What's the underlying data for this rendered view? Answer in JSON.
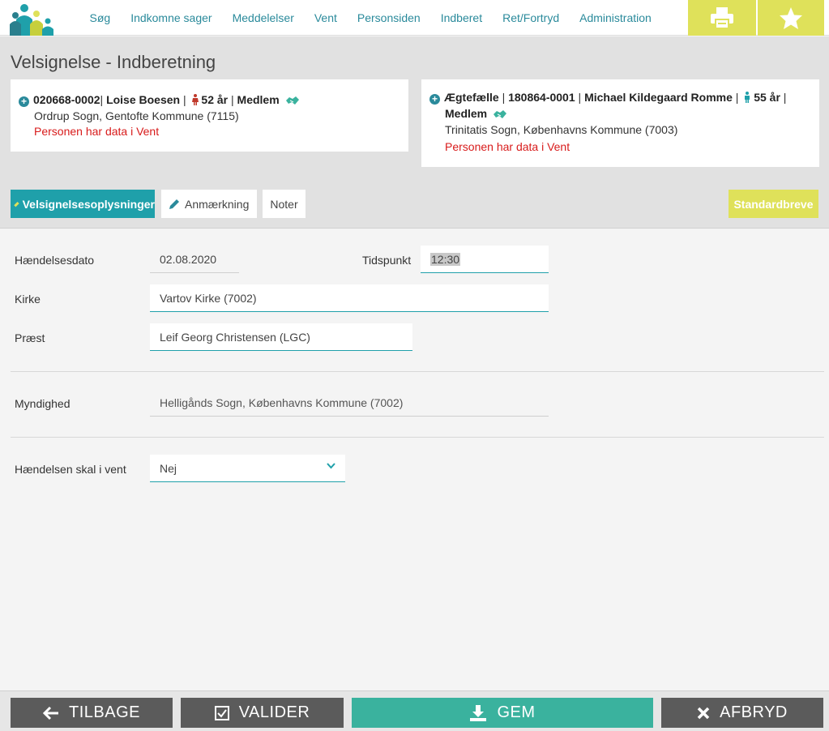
{
  "nav": {
    "items": [
      "Søg",
      "Indkomne sager",
      "Meddelelser",
      "Vent",
      "Personsiden",
      "Indberet",
      "Ret/Fortryd",
      "Administration"
    ]
  },
  "icons": {
    "logo": "people-logo-icon",
    "print": "printer-icon",
    "star": "star-icon",
    "expand": "plus-circle-icon",
    "gender_female": "female-person-icon",
    "gender_male": "male-person-icon",
    "member": "handshake-icon",
    "edit": "pencil-icon",
    "back": "arrow-left-icon",
    "validate": "checkbox-icon",
    "save": "download-icon",
    "cancel": "close-icon",
    "dropdown": "chevron-down-icon"
  },
  "colors": {
    "accent": "#1fa0aa",
    "yellow": "#dfe15a",
    "warning": "#d81b1b",
    "save": "#3ab29e",
    "dark_button": "#5b5b5b"
  },
  "page": {
    "title": "Velsignelse - Indberetning"
  },
  "person1": {
    "id": "020668-0002",
    "sep1": "|",
    "name": "Loise Boesen",
    "sep2": "|",
    "age": "52 år",
    "sep3": "|",
    "status": "Medlem",
    "parish": "Ordrup Sogn, Gentofte Kommune (7115)",
    "warning": "Personen har data i Vent"
  },
  "person2": {
    "role": "Ægtefælle",
    "sep0": "|",
    "id": "180864-0001",
    "sep1": "|",
    "name": "Michael Kildegaard Romme",
    "sep2": "|",
    "age": "55 år",
    "sep3": "|",
    "status": "Medlem",
    "parish": "Trinitatis Sogn, Københavns Kommune (7003)",
    "warning": "Personen har data i Vent"
  },
  "tabs": {
    "active": "Velsignelsesoplysninger",
    "anmaerkning": "Anmærkning",
    "noter": "Noter",
    "standardbreve": "Standardbreve"
  },
  "form": {
    "event_date_label": "Hændelsesdato",
    "event_date": "02.08.2020",
    "time_label": "Tidspunkt",
    "time": "12:30",
    "church_label": "Kirke",
    "church": "Vartov Kirke (7002)",
    "priest_label": "Præst",
    "priest": "Leif Georg Christensen (LGC)",
    "authority_label": "Myndighed",
    "authority": "Helligånds Sogn, Københavns Kommune (7002)",
    "wait_label": "Hændelsen skal i vent",
    "wait_value": "Nej"
  },
  "bottom": {
    "back": "TILBAGE",
    "validate": "VALIDER",
    "save": "GEM",
    "cancel": "AFBRYD"
  }
}
